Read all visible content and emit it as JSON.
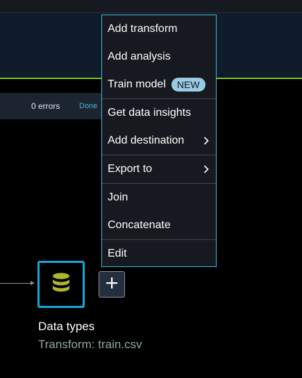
{
  "status": {
    "errors_text": "0 errors",
    "done_text": "Done"
  },
  "context_menu": {
    "items": [
      {
        "label": "Add transform"
      },
      {
        "label": "Add analysis"
      },
      {
        "label": "Train model",
        "badge": "NEW"
      },
      {
        "label": "Get data insights"
      },
      {
        "label": "Add destination",
        "has_submenu": true
      },
      {
        "label": "Export to",
        "has_submenu": true
      },
      {
        "label": "Join"
      },
      {
        "label": "Concatenate"
      },
      {
        "label": "Edit"
      }
    ]
  },
  "node": {
    "title": "Data types",
    "subtitle": "Transform: train.csv",
    "icon": "database-icon",
    "add_icon": "plus-icon"
  },
  "colors": {
    "accent": "#44b9d6",
    "node_border": "#16a6d9",
    "db_icon": "#b0b52a",
    "badge_bg": "#99cbe4",
    "divider_green": "#7fc31c"
  }
}
